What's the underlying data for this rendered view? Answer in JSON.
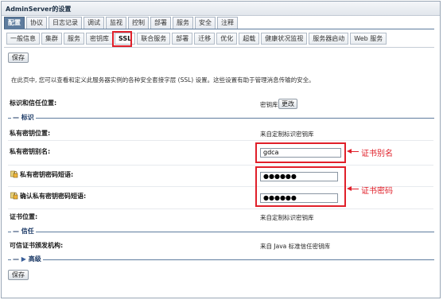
{
  "window": {
    "title": "AdminServer的设置"
  },
  "primary_tabs": [
    "配置",
    "协议",
    "日志记录",
    "调试",
    "监视",
    "控制",
    "部署",
    "服务",
    "安全",
    "注释"
  ],
  "secondary_tabs": [
    "一般信息",
    "集群",
    "服务",
    "密钥库",
    "SSL",
    "联合服务",
    "部署",
    "迁移",
    "优化",
    "超载",
    "健康状况监视",
    "服务器启动",
    "Web 服务"
  ],
  "toolbar": {
    "save_label": "保存"
  },
  "description": "在此页中, 您可以查看和定义此服务器实例的各种安全套接字层 (SSL) 设置。这些设置有助于管理消息传输的安全。",
  "identity_trust_location": {
    "label": "标识和信任位置:",
    "value": "密钥库",
    "change_label": "更改"
  },
  "identity_section": {
    "title": "标识"
  },
  "private_key_location": {
    "label": "私有密钥位置:",
    "value": "来自定制标识密钥库"
  },
  "private_key_alias": {
    "label": "私有密钥别名:",
    "value": "gdca"
  },
  "private_key_passphrase": {
    "label": "私有密钥密码短语:",
    "value": "●●●●●●"
  },
  "confirm_private_key_passphrase": {
    "label": "确认私有密钥密码短语:",
    "value": "●●●●●●"
  },
  "certificate_location": {
    "label": "证书位置:",
    "value": "来自定制标识密钥库"
  },
  "trust_section": {
    "title": "信任"
  },
  "trusted_ca": {
    "label": "可信证书颁发机构:",
    "value": "来自 Java 标准信任密钥库"
  },
  "advanced_section": {
    "title": "高级"
  },
  "annotations": {
    "alias": "证书别名",
    "password": "证书密码"
  },
  "colors": {
    "accent": "#5e7c9e",
    "highlight": "#e0202a"
  }
}
